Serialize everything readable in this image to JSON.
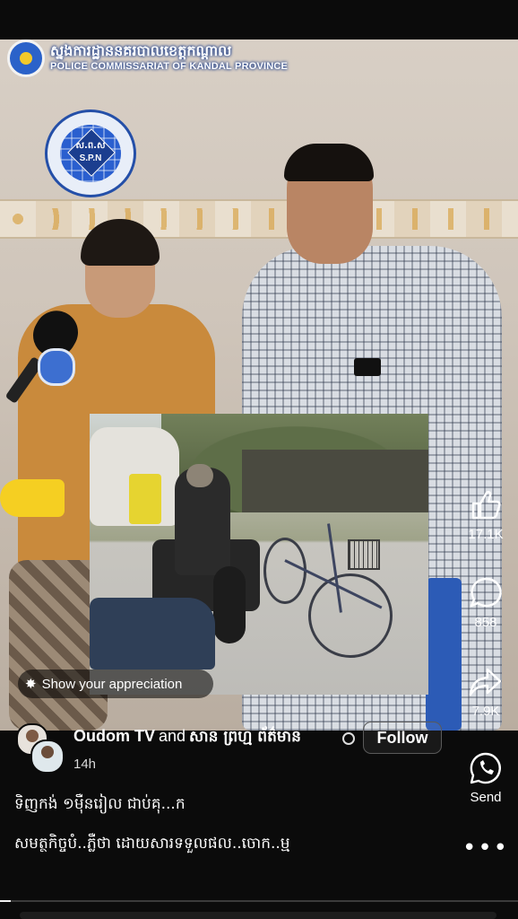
{
  "video": {
    "overlay_logo": {
      "khmer_text": "ស្នងការដ្ឋាននគរបាលខេត្តកណ្ដាល",
      "english_text": "POLICE COMMISSARIAT OF KANDAL PROVINCE"
    },
    "watermark": {
      "khmer_text": "ស.ព.ស",
      "latin_text": "S.P.N"
    },
    "appreciation_label": "Show your appreciation",
    "progress_fraction": 0.02
  },
  "actions": {
    "like_count": "17.1K",
    "comment_count": "858",
    "share_count": "7.9K",
    "send_label": "Send",
    "more_label": "•••"
  },
  "post": {
    "author_primary": "Oudom TV",
    "author_joiner": "and",
    "author_secondary": "សាន ព្រហ្ម ព័ត៌មាន",
    "follow_label": "Follow",
    "time": "14h",
    "caption_line1": "ទិញកង់ ១ម៉ឺនរៀល ជាប់គុ...ក",
    "caption_line2": "សមត្ថកិច្ចបំ..ភ្លឺថា ដោយសារទទួលផល..ចោក..ម្ម"
  },
  "icons": {
    "like": "thumbs-up-icon",
    "comment": "comment-bubble-icon",
    "share": "share-arrow-icon",
    "send": "whatsapp-icon",
    "more": "more-icon",
    "appreciation": "sparkle-star-icon",
    "audience": "globe-icon"
  },
  "colors": {
    "background": "#0b0b0b",
    "text": "#ffffff",
    "logo_blue": "#2b62c9"
  }
}
